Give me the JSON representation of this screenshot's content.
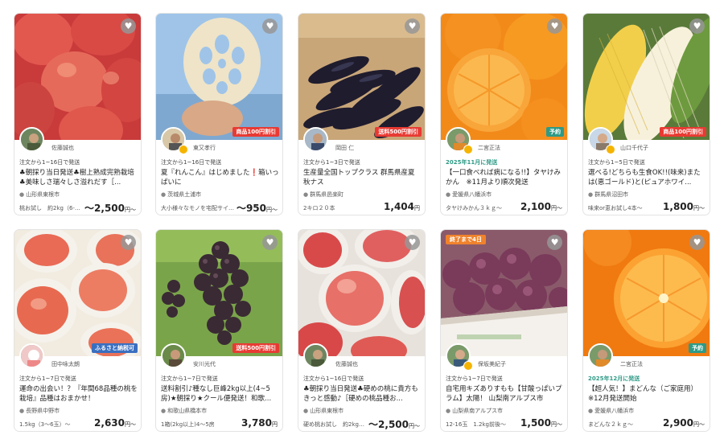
{
  "heart_icon": "♥",
  "cards": [
    {
      "seller": "佐藤誠也",
      "ship": "注文から1~16日で発送",
      "title": "♣朝採り当日発送♣樹上熟成完熟栽培♣美味しさ瑞々しさ溢れだす［...",
      "location": "山形県東根市",
      "spec": "桃お試し　約2kg（6-…",
      "price": "～2,500",
      "yen": "円～"
    },
    {
      "seller": "東又孝行",
      "ship": "注文から1~16日で発送",
      "title": "夏『れんこん』はじめました❗箱いっぱいに",
      "location": "茨城県土浦市",
      "spec": "大小様々なモノを宅配サイ…",
      "price": "～950",
      "yen": "円～",
      "badge": "商品100円割引"
    },
    {
      "seller": "岡田 仁",
      "ship": "注文から1~3日で発送",
      "title": "生産量全国トップクラス 群馬県産夏秋ナス",
      "location": "群馬県邑楽町",
      "spec": "2キロ２０本",
      "price": "1,404",
      "yen": "円",
      "badge": "送料500円割引"
    },
    {
      "seller": "二宮正法",
      "ship": "2025年11月に発送",
      "title": "【一口食べれば病になる!!】タヤけみかん　※11月より順次発送",
      "location": "愛媛県八幡浜市",
      "spec": "タヤけみかん３ｋｇ～",
      "price": "2,100",
      "yen": "円～",
      "badge": "予約"
    },
    {
      "seller": "山口千代子",
      "ship": "注文から1~5日で発送",
      "title": "選べる!どちらも生食OK!!(味来)または(恵ゴールド)と(ピュアホワイ...",
      "location": "群馬県沼田市",
      "spec": "味来or恵お試し4本～",
      "price": "1,800",
      "yen": "円～",
      "badge": "商品100円割引"
    },
    {
      "seller": "田中咏太朗",
      "ship": "注文から1~7日で発送",
      "title": "運命の出会い！？『年間68品種の桃を栽培』品種はおまかせ！",
      "location": "長野県中野市",
      "spec": "1.5kg（3～6玉）～",
      "price": "2,630",
      "yen": "円～",
      "badge": "ふるさと納税可"
    },
    {
      "seller": "安川光代",
      "ship": "注文から1~7日で発送",
      "title": "送料割引♪種なし巨峰2kg以上(4~5房)★朝採り★クール便発送！和歌...",
      "location": "和歌山県橋本市",
      "spec": "1箱(2kg以上)4～5房",
      "price": "3,780",
      "yen": "円",
      "badge": "送料500円割引"
    },
    {
      "seller": "佐藤誠也",
      "ship": "注文から1~16日で発送",
      "title": "♣朝採り当日発送♣硬めの桃に貴方もきっと感動♪［硬めの桃品種お...",
      "location": "山形県東根市",
      "spec": "硬め桃お試し　約2kg…",
      "price": "～2,500",
      "yen": "円～"
    },
    {
      "seller": "保坂美紀子",
      "ship": "注文から1~7日で発送",
      "title": "自宅用キズありすもも【甘酸っぱいプラム】太陽！ 山梨南アルプス市",
      "location": "山梨県南アルプス市",
      "spec": "12-16玉　1.2kg前後～",
      "price": "1,500",
      "yen": "円～",
      "topbadge": "終了まで4日"
    },
    {
      "seller": "二宮正法",
      "ship": "2025年12月に発送",
      "title": "【超人気！】まどんな（ご家庭用）※12月発送開始",
      "location": "愛媛県八幡浜市",
      "spec": "まどんな２ｋｇ～",
      "price": "2,900",
      "yen": "円～",
      "badge": "予約"
    }
  ]
}
